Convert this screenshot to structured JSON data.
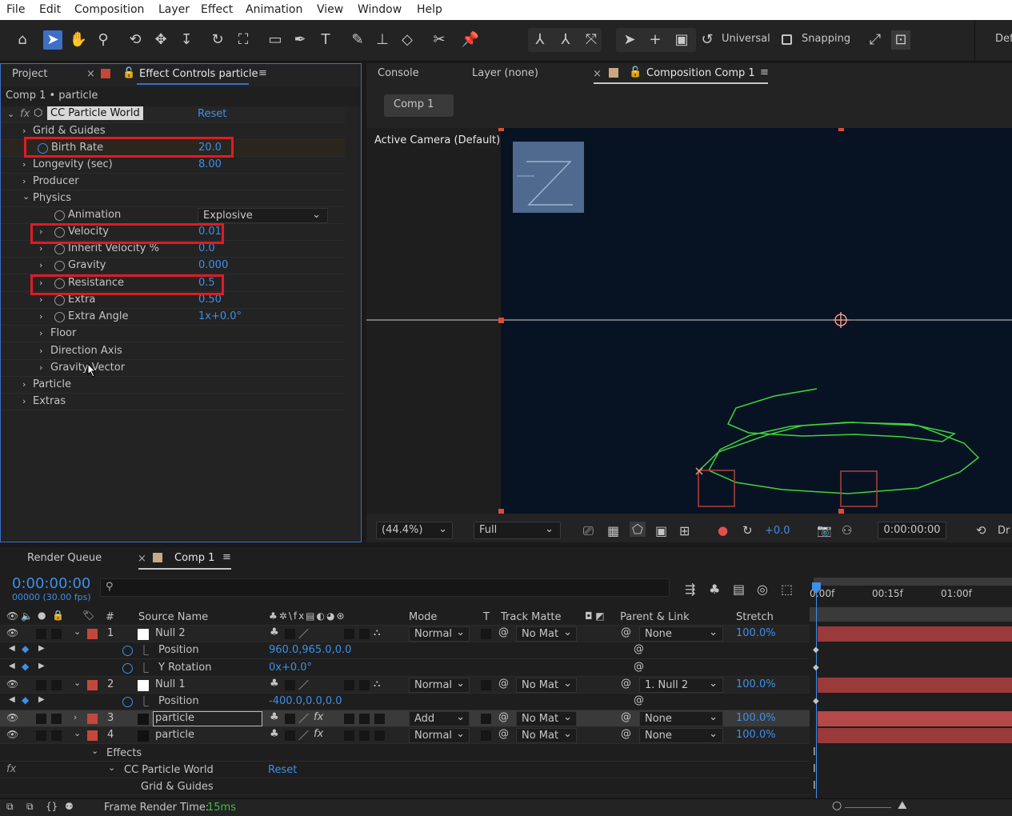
{
  "menu": [
    "File",
    "Edit",
    "Composition",
    "Layer",
    "Effect",
    "Animation",
    "View",
    "Window",
    "Help"
  ],
  "toolbar": {
    "universal": "Universal",
    "snapping": "Snapping",
    "workspace": "Def"
  },
  "effect_panel": {
    "tab_project": "Project",
    "tab_effect_controls": "Effect Controls particle",
    "breadcrumb": "Comp 1 • particle",
    "effect_name": "CC Particle World",
    "reset": "Reset",
    "props": {
      "grid_guides": "Grid & Guides",
      "birth_rate": {
        "label": "Birth Rate",
        "value": "20.0"
      },
      "longevity": {
        "label": "Longevity (sec)",
        "value": "8.00"
      },
      "producer": "Producer",
      "physics": "Physics",
      "animation": {
        "label": "Animation",
        "value": "Explosive"
      },
      "velocity": {
        "label": "Velocity",
        "value": "0.01"
      },
      "inherit_velocity": {
        "label": "Inherit Velocity %",
        "value": "0.0"
      },
      "gravity": {
        "label": "Gravity",
        "value": "0.000"
      },
      "resistance": {
        "label": "Resistance",
        "value": "0.5"
      },
      "extra": {
        "label": "Extra",
        "value": "0.50"
      },
      "extra_angle": {
        "label": "Extra Angle",
        "value": "1x+0.0°"
      },
      "floor": "Floor",
      "direction_axis": "Direction Axis",
      "gravity_vector": "Gravity Vector",
      "particle": "Particle",
      "extras": "Extras"
    }
  },
  "comp_panel": {
    "tab_console": "Console",
    "tab_layer": "Layer (none)",
    "tab_comp": "Composition Comp 1",
    "comp_button": "Comp 1",
    "camera_label": "Active Camera (Default)",
    "zoom": "(44.4%)",
    "resolution": "Full",
    "exposure": "+0.0",
    "timecode": "0:00:00:00",
    "draft": "Dr"
  },
  "timeline": {
    "tab_render_queue": "Render Queue",
    "tab_comp": "Comp 1",
    "timecode": "0:00:00:00",
    "frame_info": "00000 (30.00 fps)",
    "search_placeholder": "",
    "headers": {
      "hash": "#",
      "source_name": "Source Name",
      "mode": "Mode",
      "t": "T",
      "track_matte": "Track Matte",
      "parent": "Parent & Link",
      "stretch": "Stretch"
    },
    "ruler": [
      "0:00f",
      "00:15f",
      "01:00f"
    ],
    "layers": [
      {
        "num": "1",
        "name": "Null 2",
        "mode": "Normal",
        "matte": "No Mat",
        "parent": "None",
        "stretch": "100.0%"
      },
      {
        "num": "2",
        "name": "Null 1",
        "mode": "Normal",
        "matte": "No Mat",
        "parent": "1. Null 2",
        "stretch": "100.0%"
      },
      {
        "num": "3",
        "name": "particle",
        "mode": "Add",
        "matte": "No Mat",
        "parent": "None",
        "stretch": "100.0%"
      },
      {
        "num": "4",
        "name": "particle",
        "mode": "Normal",
        "matte": "No Mat",
        "parent": "None",
        "stretch": "100.0%"
      }
    ],
    "props": {
      "position1": {
        "label": "Position",
        "value": "960.0,965.0,0.0"
      },
      "yrot1": {
        "label": "Y Rotation",
        "value": "0x+0.0°"
      },
      "position2": {
        "label": "Position",
        "value": "-400.0,0.0,0.0"
      },
      "effects": "Effects",
      "cc_particle_world": "CC Particle World",
      "reset": "Reset",
      "grid_guides": "Grid & Guides"
    },
    "footer_label": "Frame Render Time:",
    "footer_value": "15ms"
  },
  "colors": {
    "accent": "#3d8fe8",
    "highlight": "#e01b24",
    "layer_bar": "#9b3a3a",
    "label_red": "#c4483a",
    "comp_bg": "#071322",
    "path": "#3fd33f"
  }
}
